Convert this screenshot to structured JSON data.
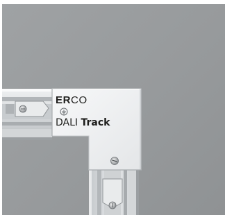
{
  "photo": {
    "subject": "corner-connector",
    "logo": {
      "prefix": "ER",
      "suffix": "CO"
    },
    "product_label": {
      "light": "DALI",
      "bold": "Track"
    },
    "colors": {
      "background": "#979a9c",
      "connector_body": "#f2f3f4",
      "rail": "#d9dcde",
      "rail_shadow": "#aeb2b5",
      "text": "#1d1d1b"
    },
    "icons": [
      "screw-icon",
      "ground-symbol-icon"
    ]
  }
}
